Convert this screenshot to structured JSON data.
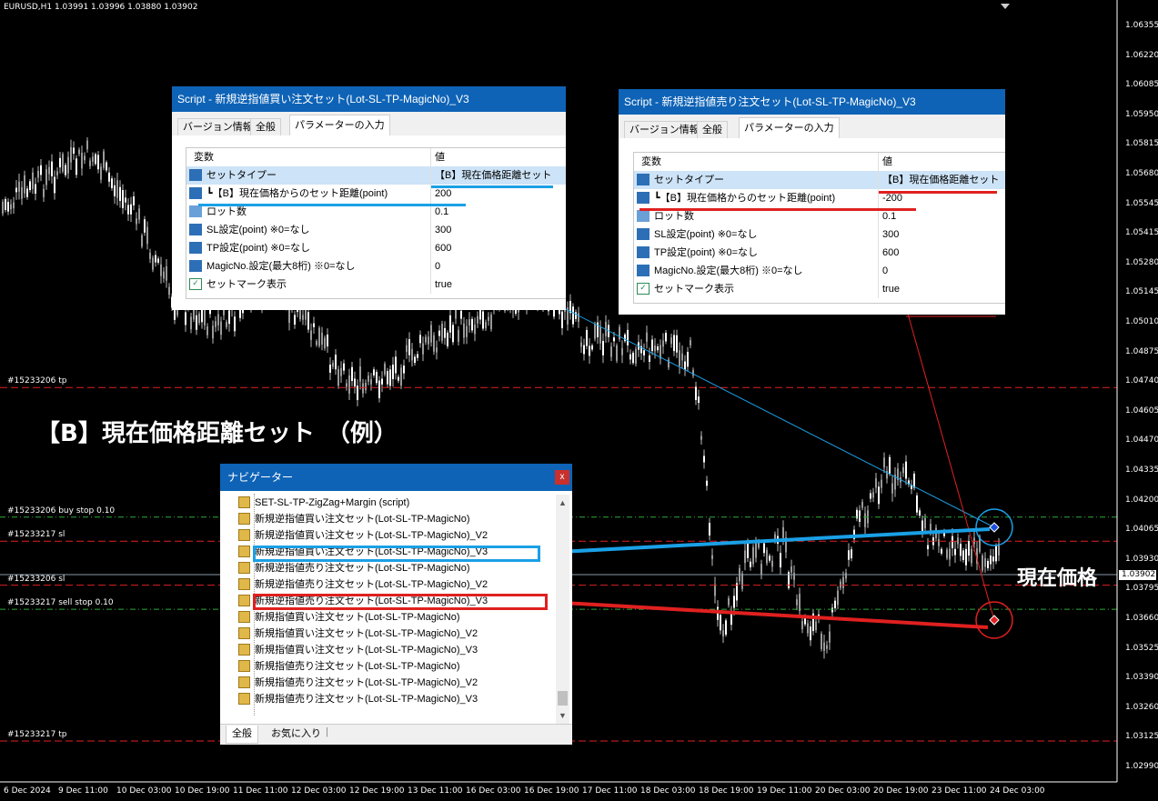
{
  "chart": {
    "symbol": "EURUSD,H1  1.03991 1.03996 1.03880 1.03902",
    "current_price": "1.03902",
    "price_axis": [
      "1.06355",
      "1.06220",
      "1.06085",
      "1.05950",
      "1.05815",
      "1.05680",
      "1.05545",
      "1.05415",
      "1.05280",
      "1.05145",
      "1.05010",
      "1.04875",
      "1.04740",
      "1.04605",
      "1.04470",
      "1.04335",
      "1.04200",
      "1.04065",
      "1.03930",
      "1.03795",
      "1.03660",
      "1.03525",
      "1.03390",
      "1.03260",
      "1.03125",
      "1.02990"
    ],
    "time_axis": [
      "6 Dec 2024",
      "9 Dec 11:00",
      "10 Dec 03:00",
      "10 Dec 19:00",
      "11 Dec 11:00",
      "12 Dec 03:00",
      "12 Dec 19:00",
      "13 Dec 11:00",
      "16 Dec 03:00",
      "16 Dec 19:00",
      "17 Dec 11:00",
      "18 Dec 03:00",
      "18 Dec 19:00",
      "19 Dec 11:00",
      "20 Dec 03:00",
      "20 Dec 19:00",
      "23 Dec 11:00",
      "24 Dec 03:00"
    ],
    "order_lines": [
      {
        "label": "#15233206 tp",
        "price": 1.0471,
        "kind": "tp"
      },
      {
        "label": "#15233206 buy stop 0.10",
        "price": 1.0412,
        "kind": "entry"
      },
      {
        "label": "#15233217 sl",
        "price": 1.0401,
        "kind": "sl"
      },
      {
        "label": "#15233206 sl",
        "price": 1.0381,
        "kind": "sl"
      },
      {
        "label": "#15233217 sell stop 0.10",
        "price": 1.037,
        "kind": "entry"
      },
      {
        "label": "#15233217 tp",
        "price": 1.031,
        "kind": "tp"
      }
    ],
    "colors": {
      "tp_line": "#e02020",
      "entry_line": "#2eaa3a",
      "bid_line": "#8a9aa8",
      "blue_mark": "#1aa0e6",
      "red_mark": "#e02020"
    }
  },
  "captions": {
    "example": "【B】現在価格距離セット　（例）",
    "current_price_label": "現在価格"
  },
  "dialog_buy": {
    "title": "Script - 新規逆指値買い注文セット(Lot-SL-TP-MagicNo)_V3",
    "tabs": [
      "バージョン情報",
      "全般",
      "パラメーターの入力"
    ],
    "col_variable": "変数",
    "col_value": "値",
    "rows": [
      {
        "icon": "123",
        "name": "セットタイプー",
        "value": "【B】現在価格距離セット"
      },
      {
        "icon": "123",
        "name": "┗【B】現在価格からのセット距離(point)",
        "value": "200"
      },
      {
        "icon": "Va",
        "name": "ロット数",
        "value": "0.1"
      },
      {
        "icon": "123",
        "name": "SL設定(point) ※0=なし",
        "value": "300"
      },
      {
        "icon": "123",
        "name": "TP設定(point) ※0=なし",
        "value": "600"
      },
      {
        "icon": "123",
        "name": "MagicNo.設定(最大8桁) ※0=なし",
        "value": "0"
      },
      {
        "icon": "bool",
        "name": "セットマーク表示",
        "value": "true"
      }
    ]
  },
  "dialog_sell": {
    "title": "Script - 新規逆指値売り注文セット(Lot-SL-TP-MagicNo)_V3",
    "tabs": [
      "バージョン情報",
      "全般",
      "パラメーターの入力"
    ],
    "col_variable": "変数",
    "col_value": "値",
    "rows": [
      {
        "icon": "123",
        "name": "セットタイプー",
        "value": "【B】現在価格距離セット"
      },
      {
        "icon": "123",
        "name": "┗【B】現在価格からのセット距離(point)",
        "value": "-200"
      },
      {
        "icon": "Va",
        "name": "ロット数",
        "value": "0.1"
      },
      {
        "icon": "123",
        "name": "SL設定(point) ※0=なし",
        "value": "300"
      },
      {
        "icon": "123",
        "name": "TP設定(point) ※0=なし",
        "value": "600"
      },
      {
        "icon": "123",
        "name": "MagicNo.設定(最大8桁) ※0=なし",
        "value": "0"
      },
      {
        "icon": "bool",
        "name": "セットマーク表示",
        "value": "true"
      }
    ]
  },
  "navigator": {
    "title": "ナビゲーター",
    "close": "x",
    "items": [
      "SET-SL-TP-ZigZag+Margin (script)",
      "新規逆指値買い注文セット(Lot-SL-TP-MagicNo)",
      "新規逆指値買い注文セット(Lot-SL-TP-MagicNo)_V2",
      "新規逆指値買い注文セット(Lot-SL-TP-MagicNo)_V3",
      "新規逆指値売り注文セット(Lot-SL-TP-MagicNo)",
      "新規逆指値売り注文セット(Lot-SL-TP-MagicNo)_V2",
      "新規逆指値売り注文セット(Lot-SL-TP-MagicNo)_V3",
      "新規指値買い注文セット(Lot-SL-TP-MagicNo)",
      "新規指値買い注文セット(Lot-SL-TP-MagicNo)_V2",
      "新規指値買い注文セット(Lot-SL-TP-MagicNo)_V3",
      "新規指値売り注文セット(Lot-SL-TP-MagicNo)",
      "新規指値売り注文セット(Lot-SL-TP-MagicNo)_V2",
      "新規指値売り注文セット(Lot-SL-TP-MagicNo)_V3"
    ],
    "tabs": [
      "全般",
      "お気に入り"
    ]
  }
}
